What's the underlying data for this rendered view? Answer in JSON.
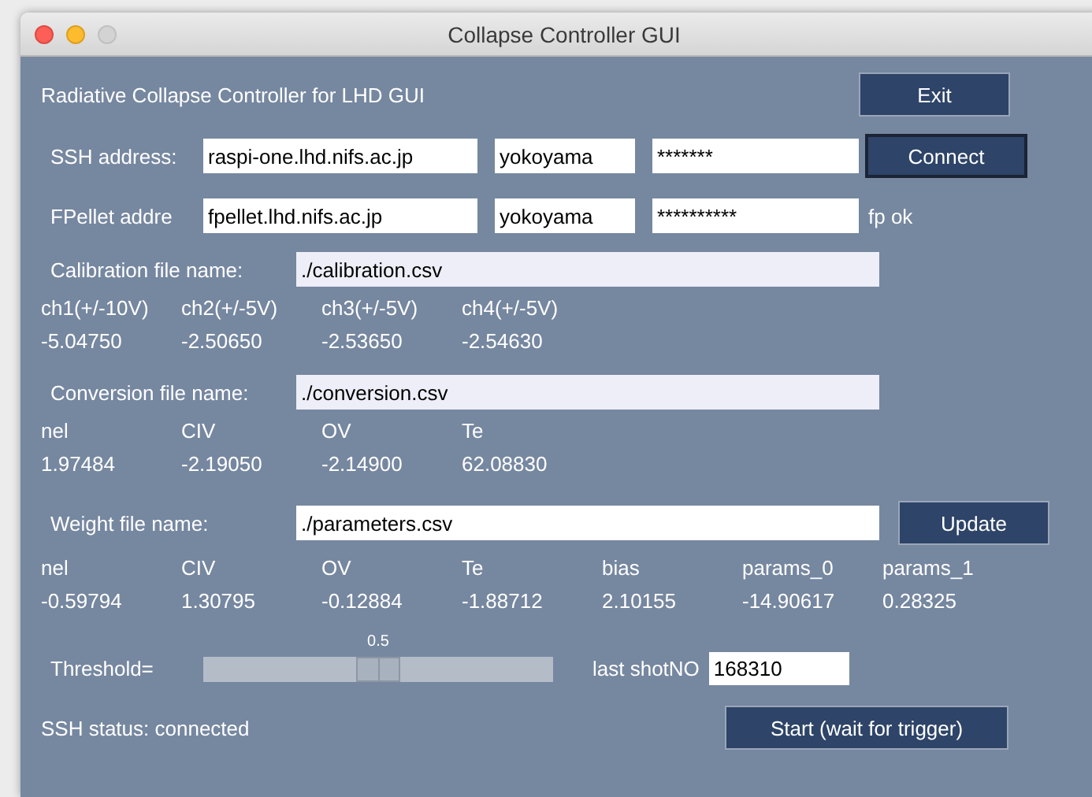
{
  "window": {
    "title": "Collapse Controller GUI"
  },
  "heading": "Radiative Collapse Controller for LHD GUI",
  "exit_button": {
    "label": "Exit",
    "focused": false
  },
  "ssh": {
    "label": "SSH address:",
    "host": "raspi-one.lhd.nifs.ac.jp",
    "user": "yokoyama",
    "password": "*******",
    "button": {
      "label": "Connect",
      "focused": true
    }
  },
  "fpellet": {
    "label": "FPellet addre",
    "host": "fpellet.lhd.nifs.ac.jp",
    "user": "yokoyama",
    "password": "**********",
    "status": "fp ok"
  },
  "calibration": {
    "label": "Calibration file name:",
    "file": "./calibration.csv",
    "readonly": true,
    "columns": [
      {
        "name": "ch1(+/-10V)",
        "value": "-5.04750"
      },
      {
        "name": "ch2(+/-5V)",
        "value": "-2.50650"
      },
      {
        "name": "ch3(+/-5V)",
        "value": "-2.53650"
      },
      {
        "name": "ch4(+/-5V)",
        "value": "-2.54630"
      }
    ]
  },
  "conversion": {
    "label": "Conversion file name:",
    "file": "./conversion.csv",
    "readonly": true,
    "columns": [
      {
        "name": "nel",
        "value": "1.97484"
      },
      {
        "name": "CIV",
        "value": "-2.19050"
      },
      {
        "name": "OV",
        "value": "-2.14900"
      },
      {
        "name": "Te",
        "value": "62.08830"
      }
    ]
  },
  "weight": {
    "label": "Weight file name:",
    "file": "./parameters.csv",
    "readonly": false,
    "button": {
      "label": "Update",
      "focused": false
    },
    "columns": [
      {
        "name": "nel",
        "value": "-0.59794"
      },
      {
        "name": "CIV",
        "value": "1.30795"
      },
      {
        "name": "OV",
        "value": "-0.12884"
      },
      {
        "name": "Te",
        "value": "-1.88712"
      },
      {
        "name": "bias",
        "value": "2.10155"
      },
      {
        "name": "params_0",
        "value": "-14.90617"
      },
      {
        "name": "params_1",
        "value": "0.28325"
      }
    ]
  },
  "threshold": {
    "label": "Threshold=",
    "reading": "0.5",
    "level": 0.5
  },
  "last_shot": {
    "label": "last shotNO",
    "value": "168310"
  },
  "ssh_status": "SSH status: connected",
  "start_button": {
    "label": "Start (wait for trigger)",
    "focused": false
  }
}
